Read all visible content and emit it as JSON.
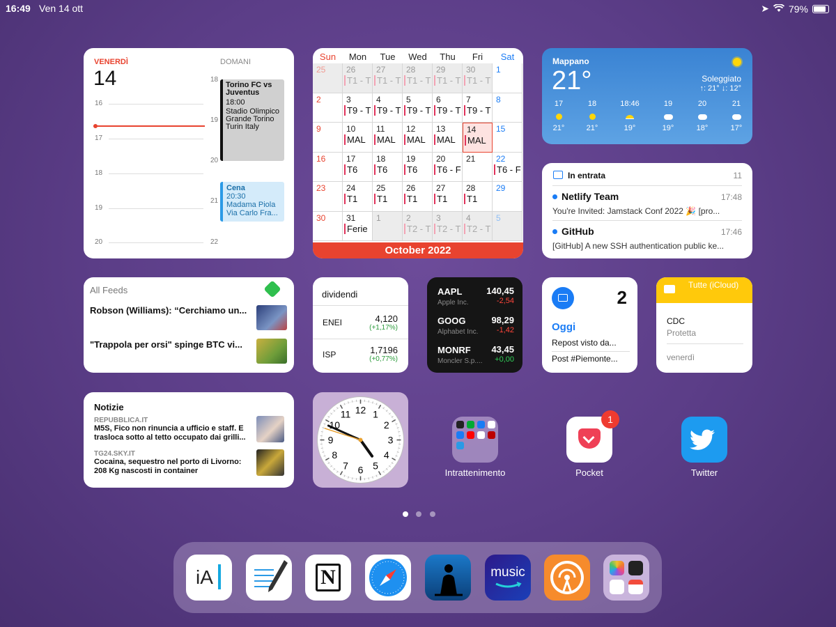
{
  "status": {
    "time": "16:49",
    "date": "Ven 14 ott",
    "battery": "79%"
  },
  "day_widget": {
    "today_label": "VENERDÌ",
    "today_num": "14",
    "tomorrow_label": "DOMANI",
    "left_hours": [
      "16",
      "17",
      "18",
      "19",
      "20"
    ],
    "right_hours": [
      "18",
      "19",
      "20",
      "21",
      "22"
    ],
    "event1": {
      "title": "Torino FC vs Juventus",
      "time": "18:00",
      "place": "Stadio Olimpico Grande Torino Turin Italy"
    },
    "event2": {
      "title": "Cena",
      "time": "20:30",
      "place": "Madama Piola Via Carlo Fra..."
    }
  },
  "month_widget": {
    "headers": [
      "Sun",
      "Mon",
      "Tue",
      "Wed",
      "Thu",
      "Fri",
      "Sat"
    ],
    "footer": "October 2022",
    "rows": [
      [
        {
          "d": "25",
          "e": "",
          "dim": true
        },
        {
          "d": "26",
          "e": "T1 - T",
          "dim": true
        },
        {
          "d": "27",
          "e": "T1 - T",
          "dim": true
        },
        {
          "d": "28",
          "e": "T1 - T",
          "dim": true
        },
        {
          "d": "29",
          "e": "T1 - T",
          "dim": true
        },
        {
          "d": "30",
          "e": "T1 - T",
          "dim": true
        },
        {
          "d": "1",
          "e": ""
        }
      ],
      [
        {
          "d": "2",
          "e": ""
        },
        {
          "d": "3",
          "e": "T9 - T"
        },
        {
          "d": "4",
          "e": "T9 - T"
        },
        {
          "d": "5",
          "e": "T9 - T"
        },
        {
          "d": "6",
          "e": "T9 - T"
        },
        {
          "d": "7",
          "e": "T9 - T"
        },
        {
          "d": "8",
          "e": ""
        }
      ],
      [
        {
          "d": "9",
          "e": ""
        },
        {
          "d": "10",
          "e": "MAL"
        },
        {
          "d": "11",
          "e": "MAL"
        },
        {
          "d": "12",
          "e": "MAL"
        },
        {
          "d": "13",
          "e": "MAL"
        },
        {
          "d": "14",
          "e": "MAL",
          "today": true
        },
        {
          "d": "15",
          "e": ""
        }
      ],
      [
        {
          "d": "16",
          "e": ""
        },
        {
          "d": "17",
          "e": "T6"
        },
        {
          "d": "18",
          "e": "T6"
        },
        {
          "d": "19",
          "e": "T6"
        },
        {
          "d": "20",
          "e": "T6 - F"
        },
        {
          "d": "21",
          "e": ""
        },
        {
          "d": "22",
          "e": "T6 - F"
        }
      ],
      [
        {
          "d": "23",
          "e": ""
        },
        {
          "d": "24",
          "e": "T1"
        },
        {
          "d": "25",
          "e": "T1"
        },
        {
          "d": "26",
          "e": "T1"
        },
        {
          "d": "27",
          "e": "T1"
        },
        {
          "d": "28",
          "e": "T1"
        },
        {
          "d": "29",
          "e": ""
        }
      ],
      [
        {
          "d": "30",
          "e": ""
        },
        {
          "d": "31",
          "e": "Ferie"
        },
        {
          "d": "1",
          "e": "",
          "dim": true
        },
        {
          "d": "2",
          "e": "T2 - T",
          "dim": true
        },
        {
          "d": "3",
          "e": "T2 - T",
          "dim": true
        },
        {
          "d": "4",
          "e": "T2 - T",
          "dim": true
        },
        {
          "d": "5",
          "e": "",
          "dim": true
        }
      ]
    ]
  },
  "weather": {
    "location": "Mappano",
    "temp": "21°",
    "condition": "Soleggiato",
    "hilo": "↑: 21° ↓: 12°",
    "hours": [
      {
        "h": "17",
        "t": "21°",
        "icon": "sun-icon"
      },
      {
        "h": "18",
        "t": "21°",
        "icon": "sun-icon"
      },
      {
        "h": "18:46",
        "t": "19°",
        "icon": "sunset-icon"
      },
      {
        "h": "19",
        "t": "19°",
        "icon": "cloud-moon-icon"
      },
      {
        "h": "20",
        "t": "18°",
        "icon": "cloud-icon"
      },
      {
        "h": "21",
        "t": "17°",
        "icon": "cloud-icon"
      }
    ]
  },
  "mail": {
    "title": "In entrata",
    "count": "11",
    "items": [
      {
        "sender": "Netlify Team",
        "time": "17:48",
        "subject": "You're Invited: Jamstack Conf 2022 🎉 [pro..."
      },
      {
        "sender": "GitHub",
        "time": "17:46",
        "subject": "[GitHub] A new SSH authentication public ke..."
      }
    ]
  },
  "feeds": {
    "title": "All Feeds",
    "items": [
      {
        "text": "Robson (Williams): “Cerchiamo un..."
      },
      {
        "text": "\"Trappola per orsi\" spinge BTC vi..."
      }
    ]
  },
  "dividendi": {
    "title": "dividendi",
    "items": [
      {
        "name": "ENEI",
        "price": "4,120",
        "change": "(+1,17%)"
      },
      {
        "name": "ISP",
        "price": "1,7196",
        "change": "(+0,77%)"
      }
    ]
  },
  "stocks": [
    {
      "sym": "AAPL",
      "name": "Apple Inc.",
      "price": "140,45",
      "change": "-2,54",
      "color": "#ff453a"
    },
    {
      "sym": "GOOG",
      "name": "Alphabet Inc.",
      "price": "98,29",
      "change": "-1,42",
      "color": "#ff453a"
    },
    {
      "sym": "MONRF",
      "name": "Moncler S.p....",
      "price": "43,45",
      "change": "+0,00",
      "color": "#30d158"
    }
  ],
  "reminders": {
    "count": "2",
    "title": "Oggi",
    "items": [
      "Repost visto da...",
      "Post #Piemonte..."
    ]
  },
  "notes": {
    "folder": "Tutte (iCloud)",
    "items": [
      {
        "title": "CDC",
        "sub": "Protetta"
      },
      {
        "title": "",
        "sub": "venerdì"
      }
    ]
  },
  "news": {
    "title": "Notizie",
    "items": [
      {
        "source": "REPUBBLICA.IT",
        "headline": "M5S, Fico non rinuncia a ufficio e staff. E trasloca sotto al tetto occupato dai grilli..."
      },
      {
        "source": "TG24.SKY.IT",
        "headline": "Cocaina, sequestro nel porto di Livorno: 208 Kg nascosti in container"
      }
    ]
  },
  "clock": {
    "numbers": [
      "12",
      "1",
      "2",
      "3",
      "4",
      "5",
      "6",
      "7",
      "8",
      "9",
      "10",
      "11"
    ],
    "hour": 4,
    "minute": 49,
    "second": 48
  },
  "apps": {
    "folder": "Intrattenimento",
    "pocket": "Pocket",
    "pocket_badge": "1",
    "twitter": "Twitter"
  },
  "dock": [
    "iA Writer",
    "Noteshelf",
    "Notion",
    "Safari",
    "Kindle",
    "Amazon Music",
    "Overcast",
    "Folder"
  ],
  "dock_labels": {
    "ia": "iA",
    "notion": "N",
    "music": "music"
  },
  "colors": {
    "red": "#e8432f",
    "blue": "#1a7cf5",
    "notes_yellow": "#ffc90b",
    "stock_bg": "#151515"
  }
}
